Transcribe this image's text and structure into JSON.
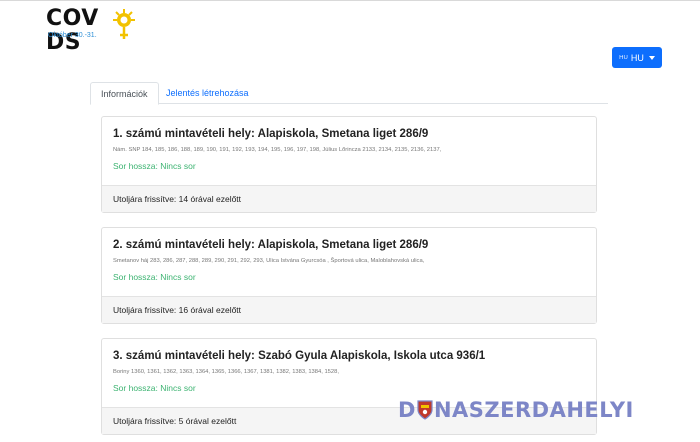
{
  "header": {
    "logo_text": "COV  DS",
    "logo_subtitle": "Október 30.-31."
  },
  "language": {
    "flag_code": "HU",
    "label": "HU"
  },
  "tabs": [
    {
      "label": "Információk",
      "active": true
    },
    {
      "label": "Jelentés létrehozása",
      "active": false
    }
  ],
  "cards": [
    {
      "title": "1. számú mintavételi hely: Alapiskola, Smetana liget 286/9",
      "streets": "Nám. SNP 184, 185, 186, 188, 189, 190, 191, 192, 193, 194, 195, 196, 197, 198, Július Lőrincza 2133, 2134, 2135, 2136, 2137,",
      "queue": "Sor hossza: Nincs sor",
      "updated": "Utoljára frissítve: 14 órával ezelőtt"
    },
    {
      "title": "2. számú mintavételi hely: Alapiskola, Smetana liget 286/9",
      "streets": "Smetanov háj 283, 286, 287, 288, 289, 290, 291, 292, 293, Ulica Istvána Gyurcsóa , Športová ulica, Maloblahovská ulica,",
      "queue": "Sor hossza: Nincs sor",
      "updated": "Utoljára frissítve: 16 órával ezelőtt"
    },
    {
      "title": "3. számú mintavételi hely: Szabó Gyula Alapiskola, Iskola utca 936/1",
      "streets": "Boriny 1360, 1361, 1362, 1363, 1364, 1365, 1366, 1367, 1381, 1382, 1383, 1384, 1528,",
      "queue": "Sor hossza: Nincs sor",
      "updated": "Utoljára frissítve: 5 órával ezelőtt"
    }
  ],
  "watermark": {
    "part1": "D",
    "part2": "NASZERDAHELYI"
  },
  "colors": {
    "primary": "#0d6efd",
    "queue_green": "#3cb371",
    "logo_yellow": "#f2c200",
    "watermark": "#7d86c7"
  }
}
